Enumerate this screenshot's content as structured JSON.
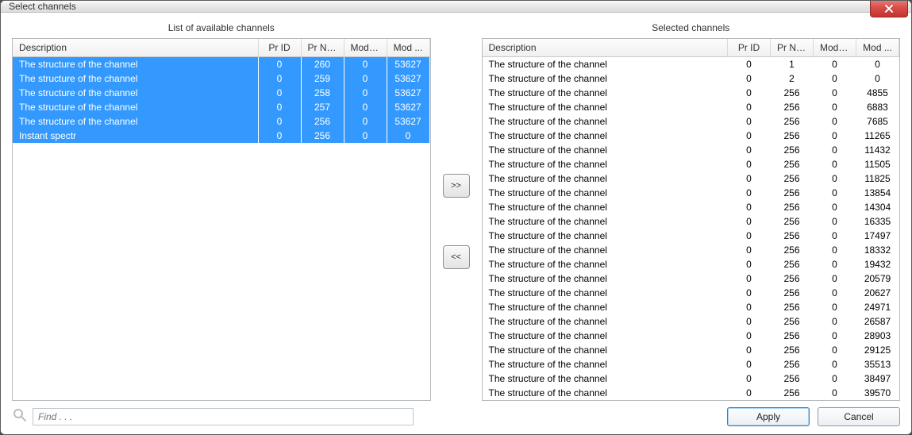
{
  "window": {
    "title": "Select channels"
  },
  "left": {
    "title": "List of available channels",
    "columns": [
      "Description",
      "Pr ID",
      "Pr Num",
      "Mod ID",
      "Mod ..."
    ],
    "rows": [
      {
        "desc": "The structure of the channel",
        "prid": 0,
        "prnum": 260,
        "modid": 0,
        "mod": 53627,
        "selected": true
      },
      {
        "desc": "The structure of the channel",
        "prid": 0,
        "prnum": 259,
        "modid": 0,
        "mod": 53627,
        "selected": true
      },
      {
        "desc": "The structure of the channel",
        "prid": 0,
        "prnum": 258,
        "modid": 0,
        "mod": 53627,
        "selected": true
      },
      {
        "desc": "The structure of the channel",
        "prid": 0,
        "prnum": 257,
        "modid": 0,
        "mod": 53627,
        "selected": true
      },
      {
        "desc": "The structure of the channel",
        "prid": 0,
        "prnum": 256,
        "modid": 0,
        "mod": 53627,
        "selected": true
      },
      {
        "desc": "Instant spectr",
        "prid": 0,
        "prnum": 256,
        "modid": 0,
        "mod": 0,
        "selected": true
      }
    ]
  },
  "right": {
    "title": "Selected channels",
    "columns": [
      "Description",
      "Pr ID",
      "Pr Num",
      "Mod ID",
      "Mod ..."
    ],
    "rows": [
      {
        "desc": "The structure of the channel",
        "prid": 0,
        "prnum": 1,
        "modid": 0,
        "mod": 0
      },
      {
        "desc": "The structure of the channel",
        "prid": 0,
        "prnum": 2,
        "modid": 0,
        "mod": 0
      },
      {
        "desc": "The structure of the channel",
        "prid": 0,
        "prnum": 256,
        "modid": 0,
        "mod": 4855
      },
      {
        "desc": "The structure of the channel",
        "prid": 0,
        "prnum": 256,
        "modid": 0,
        "mod": 6883
      },
      {
        "desc": "The structure of the channel",
        "prid": 0,
        "prnum": 256,
        "modid": 0,
        "mod": 7685
      },
      {
        "desc": "The structure of the channel",
        "prid": 0,
        "prnum": 256,
        "modid": 0,
        "mod": 11265
      },
      {
        "desc": "The structure of the channel",
        "prid": 0,
        "prnum": 256,
        "modid": 0,
        "mod": 11432
      },
      {
        "desc": "The structure of the channel",
        "prid": 0,
        "prnum": 256,
        "modid": 0,
        "mod": 11505
      },
      {
        "desc": "The structure of the channel",
        "prid": 0,
        "prnum": 256,
        "modid": 0,
        "mod": 11825
      },
      {
        "desc": "The structure of the channel",
        "prid": 0,
        "prnum": 256,
        "modid": 0,
        "mod": 13854
      },
      {
        "desc": "The structure of the channel",
        "prid": 0,
        "prnum": 256,
        "modid": 0,
        "mod": 14304
      },
      {
        "desc": "The structure of the channel",
        "prid": 0,
        "prnum": 256,
        "modid": 0,
        "mod": 16335
      },
      {
        "desc": "The structure of the channel",
        "prid": 0,
        "prnum": 256,
        "modid": 0,
        "mod": 17497
      },
      {
        "desc": "The structure of the channel",
        "prid": 0,
        "prnum": 256,
        "modid": 0,
        "mod": 18332
      },
      {
        "desc": "The structure of the channel",
        "prid": 0,
        "prnum": 256,
        "modid": 0,
        "mod": 19432
      },
      {
        "desc": "The structure of the channel",
        "prid": 0,
        "prnum": 256,
        "modid": 0,
        "mod": 20579
      },
      {
        "desc": "The structure of the channel",
        "prid": 0,
        "prnum": 256,
        "modid": 0,
        "mod": 20627
      },
      {
        "desc": "The structure of the channel",
        "prid": 0,
        "prnum": 256,
        "modid": 0,
        "mod": 24971
      },
      {
        "desc": "The structure of the channel",
        "prid": 0,
        "prnum": 256,
        "modid": 0,
        "mod": 26587
      },
      {
        "desc": "The structure of the channel",
        "prid": 0,
        "prnum": 256,
        "modid": 0,
        "mod": 28903
      },
      {
        "desc": "The structure of the channel",
        "prid": 0,
        "prnum": 256,
        "modid": 0,
        "mod": 29125
      },
      {
        "desc": "The structure of the channel",
        "prid": 0,
        "prnum": 256,
        "modid": 0,
        "mod": 35513
      },
      {
        "desc": "The structure of the channel",
        "prid": 0,
        "prnum": 256,
        "modid": 0,
        "mod": 38497
      },
      {
        "desc": "The structure of the channel",
        "prid": 0,
        "prnum": 256,
        "modid": 0,
        "mod": 39570
      }
    ]
  },
  "buttons": {
    "add": ">>",
    "remove": "<<",
    "apply": "Apply",
    "cancel": "Cancel"
  },
  "find": {
    "placeholder": "Find . . ."
  }
}
